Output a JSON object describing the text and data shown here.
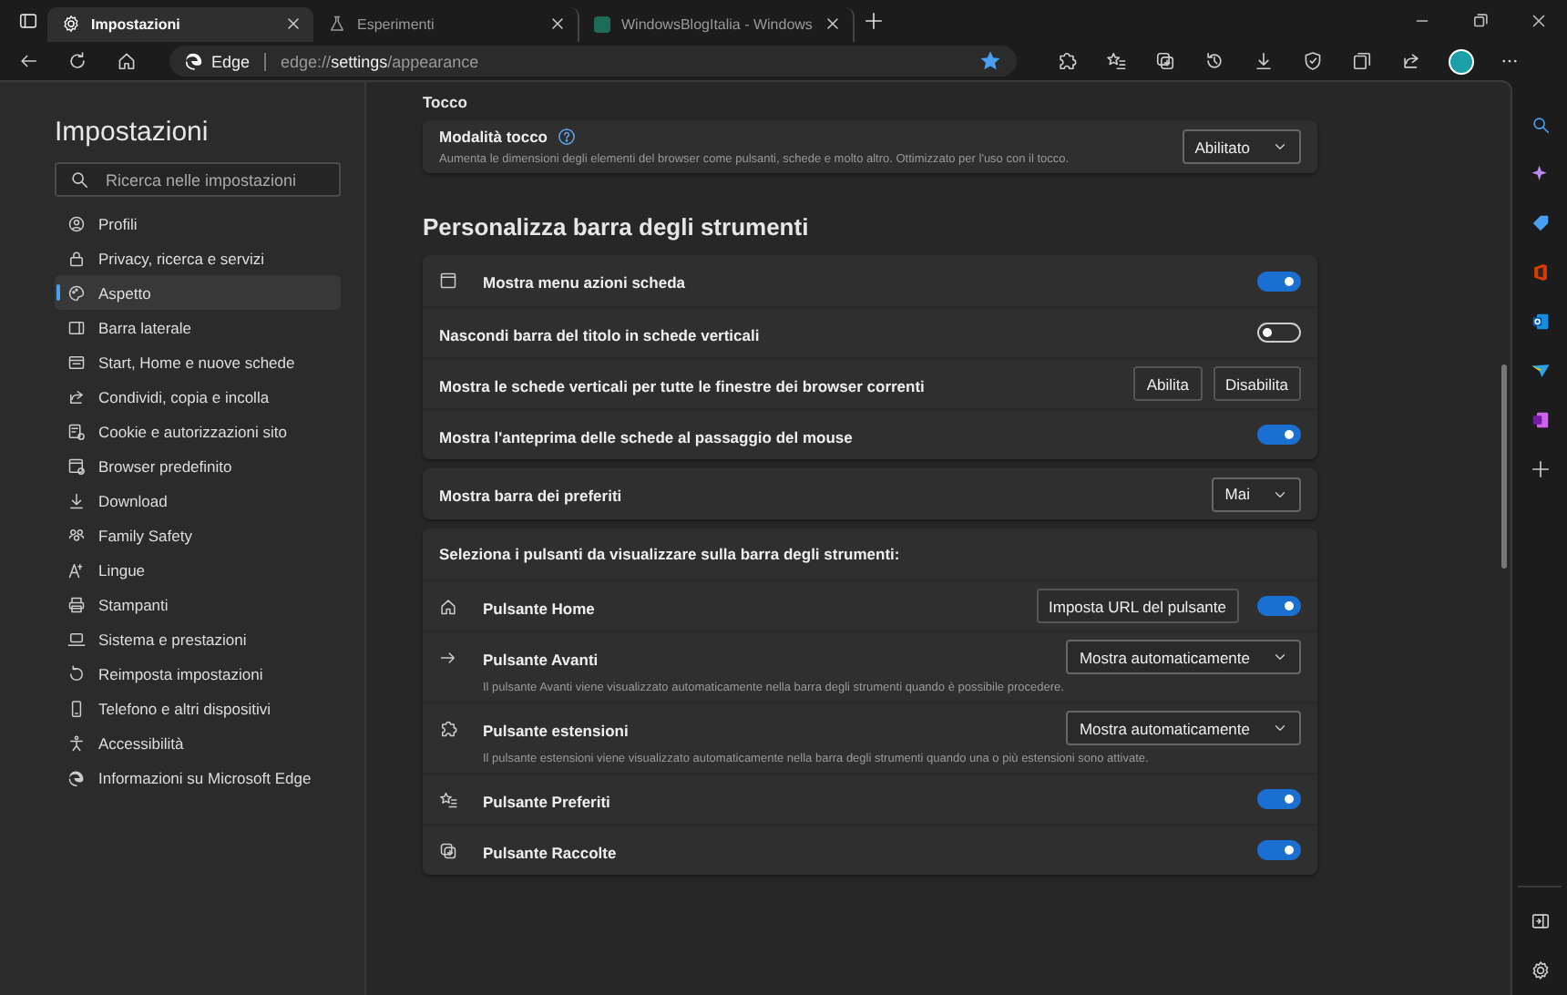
{
  "tabs": [
    {
      "label": "Impostazioni",
      "selected": true
    },
    {
      "label": "Esperimenti",
      "selected": false
    },
    {
      "label": "WindowsBlogItalia - Windows",
      "selected": false
    }
  ],
  "address": {
    "site": "Edge",
    "url": "edge://**settings**/appearance",
    "favorite": true
  },
  "settings": {
    "title": "Impostazioni",
    "search": {
      "placeholder": "Ricerca nelle impostazioni"
    },
    "nav": [
      {
        "label": "Profili",
        "selected": false
      },
      {
        "label": "Privacy, ricerca e servizi",
        "selected": false
      },
      {
        "label": "Aspetto",
        "selected": true
      },
      {
        "label": "Barra laterale",
        "selected": false
      },
      {
        "label": "Start, Home e nuove schede",
        "selected": false
      },
      {
        "label": "Condividi, copia e incolla",
        "selected": false
      },
      {
        "label": "Cookie e autorizzazioni sito",
        "selected": false
      },
      {
        "label": "Browser predefinito",
        "selected": false
      },
      {
        "label": "Download",
        "selected": false
      },
      {
        "label": "Family Safety",
        "selected": false
      },
      {
        "label": "Lingue",
        "selected": false
      },
      {
        "label": "Stampanti",
        "selected": false
      },
      {
        "label": "Sistema e prestazioni",
        "selected": false
      },
      {
        "label": "Reimposta impostazioni",
        "selected": false
      },
      {
        "label": "Telefono e altri dispositivi",
        "selected": false
      },
      {
        "label": "Accessibilità",
        "selected": false
      },
      {
        "label": "Informazioni su Microsoft Edge",
        "selected": false
      }
    ]
  },
  "touch": {
    "heading": "Tocco",
    "title": "Modalità tocco",
    "description": "Aumenta le dimensioni degli elementi del browser come pulsanti, schede e molto altro. Ottimizzato per l'uso con il tocco.",
    "value": "Abilitato"
  },
  "toolbar": {
    "heading": "Personalizza barra degli strumenti",
    "cards": [
      {
        "rows": [
          {
            "kind": "toggle",
            "label": "Mostra menu azioni scheda",
            "on": true
          },
          {
            "kind": "toggle",
            "label": "Nascondi barra del titolo in schede verticali",
            "on": false
          },
          {
            "kind": "buttons",
            "label": "Mostra le schede verticali per tutte le finestre dei browser correnti",
            "buttons": [
              "Abilita",
              "Disabilita"
            ]
          },
          {
            "kind": "toggle",
            "label": "Mostra l'anteprima delle schede al passaggio del mouse",
            "on": true
          }
        ]
      },
      {
        "rows": [
          {
            "kind": "dropdown",
            "label": "Mostra barra dei preferiti",
            "value": "Mai"
          }
        ]
      },
      {
        "header": "Seleziona i pulsanti da visualizzare sulla barra degli strumenti:",
        "rows": [
          {
            "kind": "button_toggle",
            "label": "Pulsante Home",
            "button": "Imposta URL del pulsante",
            "on": true
          },
          {
            "kind": "dropdown",
            "label": "Pulsante Avanti",
            "description": "Il pulsante Avanti viene visualizzato automaticamente nella barra degli strumenti quando è possibile procedere.",
            "value": "Mostra automaticamente"
          },
          {
            "kind": "dropdown",
            "label": "Pulsante estensioni",
            "description": "Il pulsante estensioni viene visualizzato automaticamente nella barra degli strumenti quando una o più estensioni sono attivate.",
            "value": "Mostra automaticamente"
          },
          {
            "kind": "toggle",
            "label": "Pulsante Preferiti",
            "on": true
          },
          {
            "kind": "toggle",
            "label": "Pulsante Raccolte",
            "on": true
          }
        ]
      }
    ]
  }
}
